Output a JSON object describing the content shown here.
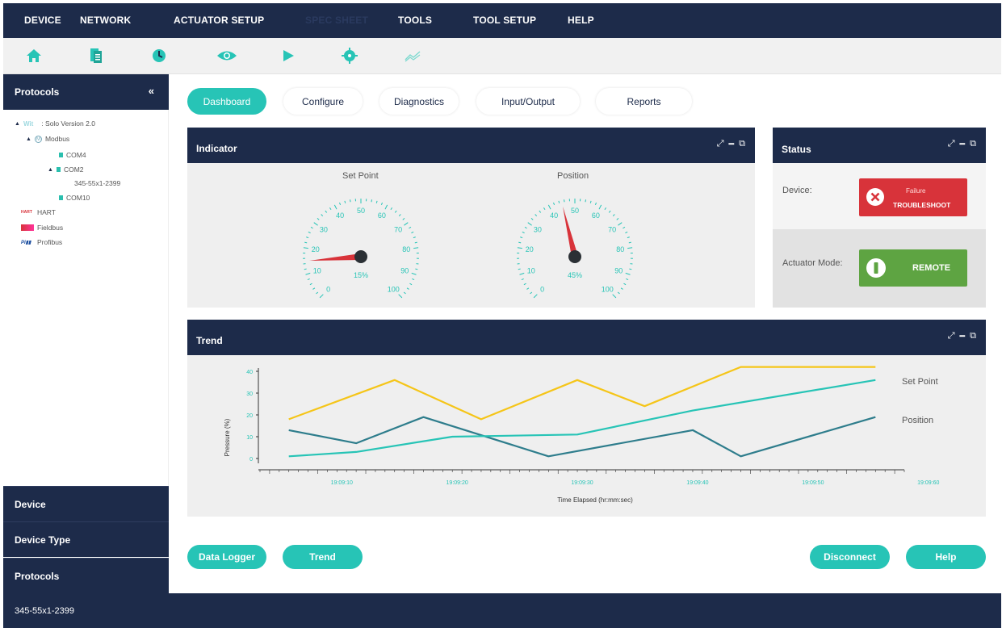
{
  "menu": [
    "DEVICE",
    "NETWORK",
    "ACTUATOR SETUP",
    "SPEC SHEET",
    "TOOLS",
    "TOOL SETUP",
    "HELP"
  ],
  "toolbar_icons": [
    "home-icon",
    "document-icon",
    "clock-icon",
    "eye-icon",
    "play-icon",
    "target-icon",
    "trend-icon"
  ],
  "sidebar": {
    "title": "Protocols",
    "collapse": "«",
    "tree": {
      "root": ": Solo Version 2.0",
      "modbus": "Modbus",
      "com4": "COM4",
      "com2": "COM2",
      "device": "345-55x1-2399",
      "com10": "COM10",
      "hart": "HART",
      "fieldbus": "Fieldbus",
      "profibus": "Profibus"
    },
    "footer": [
      "Device",
      "Device Type",
      "Protocols"
    ]
  },
  "tabs": [
    "Dashboard",
    "Configure",
    "Diagnostics",
    "Input/Output",
    "Reports"
  ],
  "indicator": {
    "title": "Indicator",
    "setpoint": {
      "label": "Set Point",
      "value": 15,
      "display": "15%"
    },
    "position": {
      "label": "Position",
      "value": 45,
      "display": "45%"
    },
    "scale": [
      "0",
      "10",
      "20",
      "30",
      "40",
      "50",
      "60",
      "70",
      "80",
      "90",
      "100"
    ]
  },
  "status": {
    "title": "Status",
    "device_label": "Device:",
    "failure": "Failure",
    "troubleshoot": "TROUBLESHOOT",
    "mode_label": "Actuator Mode:",
    "remote": "REMOTE"
  },
  "trend": {
    "title": "Trend",
    "ylabel": "Pressure (%)",
    "xlabel": "Time Elapsed (hr:mm:sec)",
    "yticks": [
      "0",
      "10",
      "20",
      "30",
      "40"
    ],
    "xticks": [
      "19:09:10",
      "19:09:20",
      "19:09:30",
      "19:09:40",
      "19:09:50",
      "19:09:60"
    ],
    "series_labels": {
      "setpoint": "Set Point",
      "position": "Position"
    }
  },
  "chart_data": {
    "type": "line",
    "xlabel": "Time Elapsed (hr:mm:sec)",
    "ylabel": "Pressure (%)",
    "ylim": [
      0,
      40
    ],
    "x": [
      "19:09:07",
      "19:09:14",
      "19:09:18",
      "19:09:21",
      "19:09:27",
      "19:09:34",
      "19:09:37",
      "19:09:42",
      "19:09:44",
      "19:09:49",
      "19:09:54",
      "19:10:08"
    ],
    "series": [
      {
        "name": "Set Point",
        "color": "#f5c518",
        "points": [
          [
            "19:09:07",
            18
          ],
          [
            "19:09:18",
            36
          ],
          [
            "19:09:27",
            18
          ],
          [
            "19:09:37",
            36
          ],
          [
            "19:09:44",
            24
          ],
          [
            "19:09:54",
            42
          ],
          [
            "19:10:08",
            42
          ]
        ]
      },
      {
        "name": "Position",
        "color": "#2e7d8c",
        "points": [
          [
            "19:09:07",
            13
          ],
          [
            "19:09:14",
            7
          ],
          [
            "19:09:21",
            19
          ],
          [
            "19:09:34",
            1
          ],
          [
            "19:09:49",
            13
          ],
          [
            "19:09:54",
            1
          ],
          [
            "19:10:08",
            19
          ]
        ]
      },
      {
        "color": "#27c4b6",
        "points": [
          [
            "19:09:07",
            1
          ],
          [
            "19:09:14",
            3
          ],
          [
            "19:09:24",
            10
          ],
          [
            "19:09:37",
            11
          ],
          [
            "19:09:49",
            22
          ],
          [
            "19:10:08",
            36
          ]
        ]
      }
    ]
  },
  "bottom_buttons": {
    "data_logger": "Data Logger",
    "trend": "Trend",
    "disconnect": "Disconnect",
    "help": "Help"
  },
  "statusbar": "345-55x1-2399",
  "colors": {
    "navy": "#1d2b4a",
    "teal": "#27c4b6",
    "red": "#d8333a",
    "green": "#5ea442",
    "yellow": "#f5c518"
  }
}
